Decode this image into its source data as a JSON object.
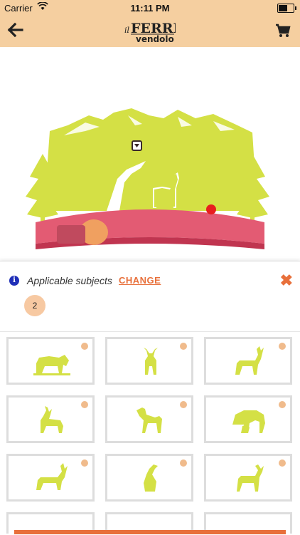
{
  "status_bar": {
    "carrier": "Carrier",
    "time": "11:11 PM"
  },
  "nav": {
    "brand_small": "il",
    "brand_top": "FERRI",
    "brand_bottom": "vendolo",
    "back_icon": "arrow-left-icon",
    "cart_icon": "shopping-cart-icon"
  },
  "colors": {
    "accent": "#e8703b",
    "header_bg": "#f5cfa0",
    "silhouette": "#d4e045",
    "base": "#e35b73",
    "badge": "#f7c9a2"
  },
  "panel": {
    "info_icon": "i",
    "title": "Applicable subjects",
    "change_label": "CHANGE",
    "close_label": "✖",
    "count": "2"
  },
  "subjects": [
    "grazing-horse-icon",
    "standing-deer-front-icon",
    "deer-with-antlers-icon",
    "young-deer-icon",
    "fawn-icon",
    "doe-and-fawn-icon",
    "walking-stag-icon",
    "sitting-bird-icon",
    "stag-side-icon"
  ]
}
